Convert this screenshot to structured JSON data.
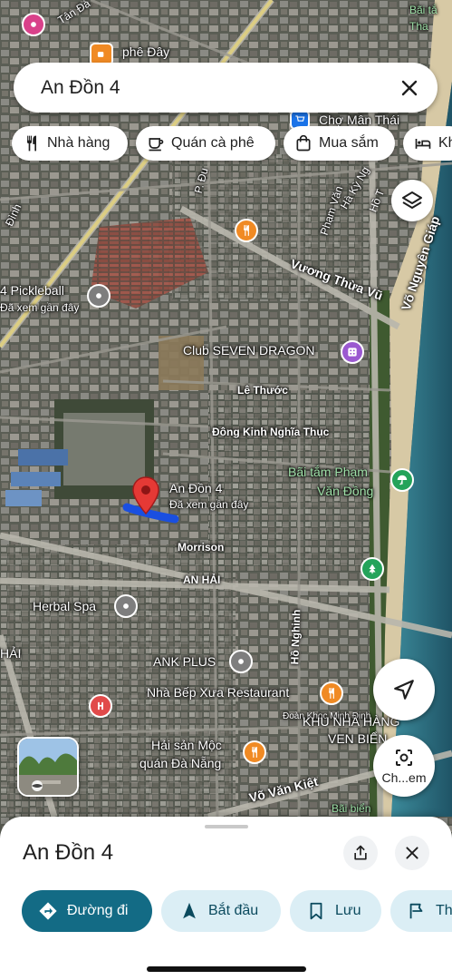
{
  "search": {
    "query": "An Đồn 4"
  },
  "chips": [
    {
      "label": "Nhà hàng",
      "icon": "fork-knife-icon"
    },
    {
      "label": "Quán cà phê",
      "icon": "coffee-cup-icon"
    },
    {
      "label": "Mua sắm",
      "icon": "shopping-bag-icon"
    },
    {
      "label": "Kh",
      "icon": "bed-icon"
    }
  ],
  "map": {
    "labels": {
      "top_left_street": "Tân Đà",
      "phe_day": "phê  Đây",
      "bai_tam_top": "Bãi tắ",
      "bai_tam_top2": "Tha",
      "cho_man_thai": "Chợ Mân Thái",
      "pham_van": "Phạm Văn",
      "ha_ky_ng": "Hà Kỳ Ng",
      "ho_top": "Hồ T",
      "p_du": "P. Đu",
      "dinh": "Đình",
      "vuong_thua_vu": "Vương Thừa Vũ",
      "vo_nguyen_giap": "Võ Nguyên Giáp",
      "pickleball": "4 Pickleball",
      "pickleball_sub": "Đã xem gần đây",
      "club_seven_dragon": "Club SEVEN DRAGON",
      "le_thuoc": "Lê Thước",
      "dong_kinh": "Đông Kinh Nghĩa Thục",
      "bai_tam_pvd_1": "Bãi tắm Phạm",
      "bai_tam_pvd_2": "Văn Đồng",
      "an_don_4": "An Đồn 4",
      "an_don_4_sub": "Đã xem gần đây",
      "morrison": "Morrison",
      "an_hai": "AN HẢI",
      "herbal_spa": "Herbal Spa",
      "ho_nghinh": "Hồ Nghinh",
      "hai": "HẢI",
      "ank_plus": "ANK PLUS",
      "nha_bep_xua": "Nhà Bếp Xưa Restaurant",
      "doan_khoc": "Đoàn Khoc Minh Định",
      "khu_nha_hang": "KHU NHÀ HÀNG",
      "ven_bien": "VEN BIỂN",
      "hai_san_1": "Hải sản Mộc",
      "hai_san_2": "quán Đà Nẵng",
      "vo_van_kiet": "Võ Văn Kiệt",
      "bai_bien": "Bãi biển"
    },
    "poi_colors": {
      "restaurant": "#f08a24",
      "nightlife": "#9b59d0",
      "park": "#24a35a",
      "hospital": "#e14a4a",
      "place": "#7e7e7e",
      "pin": "#e53935",
      "route": "#1a4fe0"
    }
  },
  "buttons": {
    "translate_label": "Ch...em"
  },
  "place": {
    "title": "An Đồn 4"
  },
  "actions": [
    {
      "label": "Đường đi",
      "icon": "directions-icon"
    },
    {
      "label": "Bắt đầu",
      "icon": "navigation-arrow-icon"
    },
    {
      "label": "Lưu",
      "icon": "bookmark-icon"
    },
    {
      "label": "Th",
      "icon": "flag-icon"
    }
  ],
  "colors": {
    "accent": "#136b85",
    "action_bg": "#dbeef5",
    "action_text": "#0b4a5e"
  }
}
